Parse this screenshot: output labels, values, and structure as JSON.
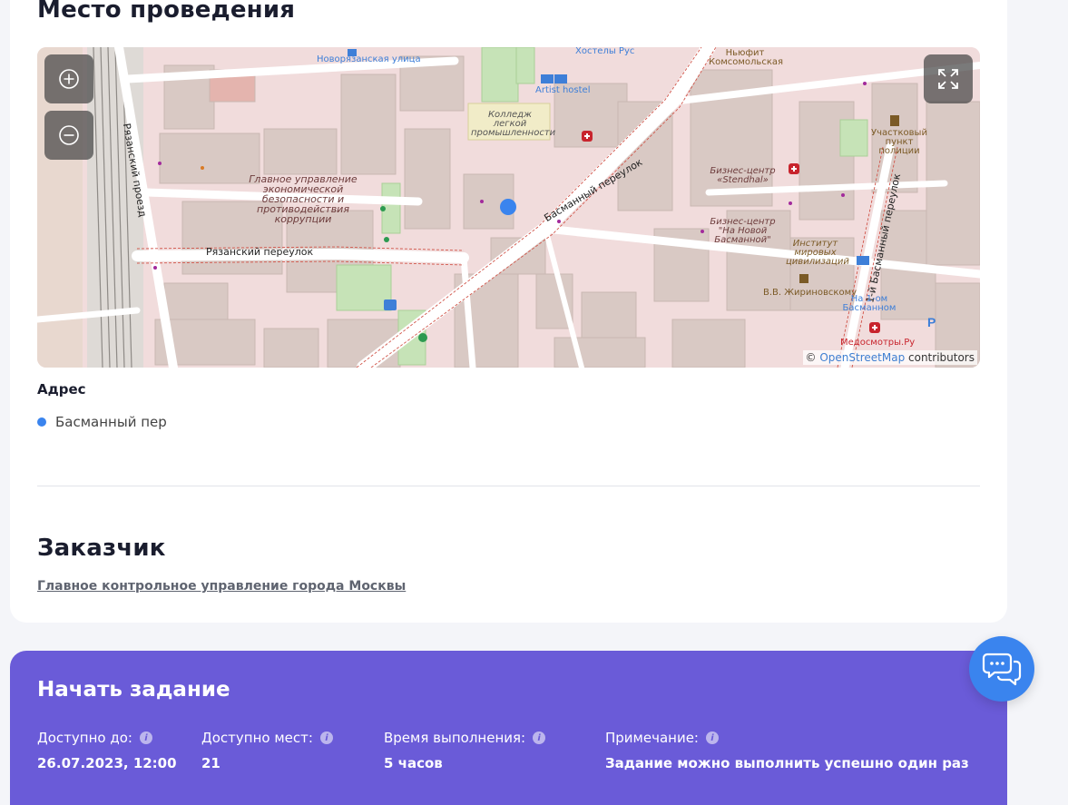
{
  "venue": {
    "title": "Место проведения",
    "address_label": "Адрес",
    "address": "Басманный пер"
  },
  "map": {
    "zoom_in_icon": "zoom-in-icon",
    "zoom_out_icon": "zoom-out-icon",
    "fullscreen_icon": "fullscreen-icon",
    "attribution_prefix": "©",
    "attribution_link": "OpenStreetMap",
    "attribution_suffix": "contributors",
    "labels": {
      "basmanny_lane": "Басманный переулок",
      "ryazansky_lane": "Рязанский переулок",
      "ryazansky_proezd": "Рязанский проезд",
      "novoryazanskaya": "Новорязанская улица",
      "artist_hostel": "Artist hostel",
      "college": "Колледж легкой промышленности",
      "gueb": "Главное управление экономической безопасности и противодействия коррупции",
      "stendhal": "Бизнес-центр «Stendhal»",
      "novaya_basmanny": "Бизнес-центр \"На Новой Басманной\"",
      "institute": "Институт мировых цивилизаций",
      "zhirinovsky": "В.В. Жириновскому",
      "na_1om": "На 1-ом Басманном",
      "medosmotry": "Медосмотры.Ру",
      "police": "Участковый пункт полиции",
      "first_basmanny": "1-й Басманный переулок",
      "newton": "Ньюфит Комсомольская",
      "hostel_rus": "Хостелы Рус"
    }
  },
  "customer": {
    "title": "Заказчик",
    "name": "Главное контрольное управление города Москвы"
  },
  "task": {
    "title": "Начать задание",
    "fields": [
      {
        "label": "Доступно до:",
        "value": "26.07.2023, 12:00"
      },
      {
        "label": "Доступно мест:",
        "value": "21"
      },
      {
        "label": "Время выполнения:",
        "value": "5 часов"
      },
      {
        "label": "Примечание:",
        "value": "Задание можно выполнить успешно один раз"
      }
    ]
  },
  "chat": {
    "icon": "chat-icon"
  },
  "colors": {
    "accent": "#3a84ee",
    "task_bg": "#6a5bd8",
    "map_bg": "#f1dcdc"
  }
}
